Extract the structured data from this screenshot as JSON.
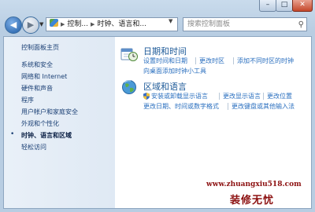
{
  "window": {
    "controls": {
      "minimize": "–",
      "maximize": "□",
      "close": "✕"
    }
  },
  "navbar": {
    "address_segments": [
      "控制...",
      "时钟、语言和..."
    ],
    "search_placeholder": "搜索控制面板"
  },
  "sidebar": {
    "items": [
      {
        "label": "控制面板主页"
      },
      {
        "label": "系统和安全"
      },
      {
        "label": "网络和 Internet"
      },
      {
        "label": "硬件和声音"
      },
      {
        "label": "程序"
      },
      {
        "label": "用户帐户和家庭安全"
      },
      {
        "label": "外观和个性化"
      },
      {
        "label": "时钟、语言和区域",
        "active": true
      },
      {
        "label": "轻松访问"
      }
    ]
  },
  "main": {
    "datetime": {
      "title": "日期和时间",
      "links_row1": [
        "设置时间和日期",
        "更改时区",
        "添加不同时区的时钟"
      ],
      "links_row2": [
        "向桌面添加时钟小工具"
      ]
    },
    "region": {
      "title": "区域和语言",
      "links_row1": [
        "安装或卸载显示语言",
        "更改显示语言",
        "更改位置"
      ],
      "links_row2": [
        "更改日期、时间或数字格式",
        "更改键盘或其他输入法"
      ]
    }
  },
  "watermark": {
    "url": "www.zhuangxiu518.com",
    "text": "装修无忧"
  },
  "colors": {
    "link": "#2a6fbf",
    "title": "#1d5a98",
    "sidebar": "#1a3f74"
  }
}
